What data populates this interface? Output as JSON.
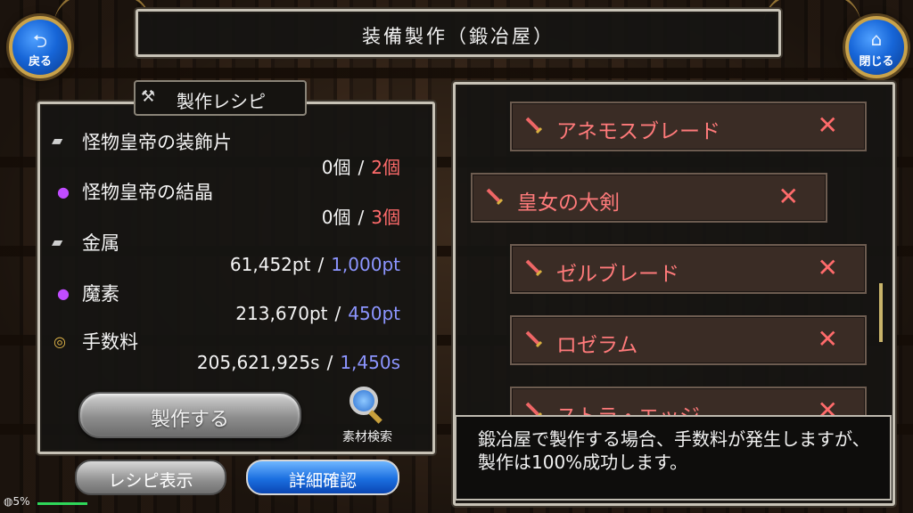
{
  "header": {
    "title": "装備製作（鍛冶屋）",
    "back_label": "戻る",
    "close_label": "閉じる"
  },
  "recipe": {
    "heading": "製作レシピ",
    "materials": [
      {
        "name": "怪物皇帝の装飾片",
        "icon": "ingot-icon",
        "have": "0個",
        "need": "2個",
        "need_color": "#ff6b6b"
      },
      {
        "name": "怪物皇帝の結晶",
        "icon": "purple-orb-icon",
        "have": "0個",
        "need": "3個",
        "need_color": "#ff6b6b"
      },
      {
        "name": "金属",
        "icon": "ingot-icon",
        "have": "61,452pt",
        "need": "1,000pt",
        "need_color": "#8c95ff"
      },
      {
        "name": "魔素",
        "icon": "purple-orb-icon",
        "have": "213,670pt",
        "need": "450pt",
        "need_color": "#8c95ff"
      },
      {
        "name": "手数料",
        "icon": "coins-icon",
        "have": "205,621,925s",
        "need": "1,450s",
        "need_color": "#8c95ff"
      }
    ],
    "separator": "/",
    "make_button": "製作する",
    "search_label": "素材検索"
  },
  "bottom_buttons": {
    "show_recipe": "レシピ表示",
    "details": "詳細確認"
  },
  "equipment_list": [
    {
      "name": "アネモスブレード",
      "mark": "✕"
    },
    {
      "name": "皇女の大剣",
      "mark": "✕"
    },
    {
      "name": "ゼルブレード",
      "mark": "✕"
    },
    {
      "name": "ロゼラム",
      "mark": "✕"
    },
    {
      "name": "ストラ・エッジ",
      "mark": "✕"
    }
  ],
  "message": "鍛冶屋で製作する場合、手数料が発生しますが、製作は100%成功します。",
  "status": {
    "percent": "5%"
  },
  "colors": {
    "accent_blue": "#1b6fe0",
    "error_red": "#ff6b6b",
    "need_blue": "#8c95ff",
    "frame_gold": "#c9a24a"
  }
}
